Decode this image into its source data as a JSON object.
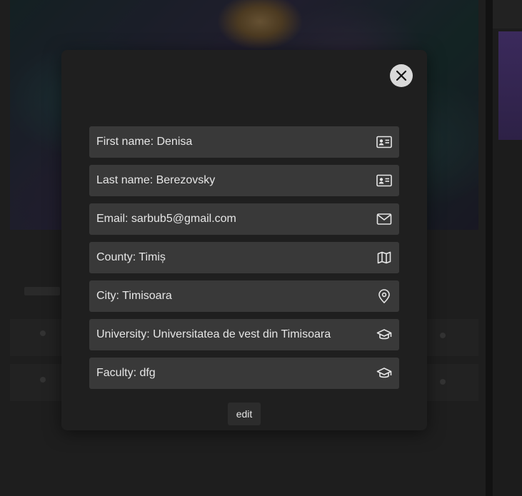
{
  "colors": {
    "modal_bg": "#1f1f1f",
    "field_bg": "#393939",
    "text": "#e6e6e6",
    "close_bg": "#d9d9d9"
  },
  "modal": {
    "fields": [
      {
        "label": "First name: Denisa",
        "icon": "id-card-icon"
      },
      {
        "label": "Last name: Berezovsky",
        "icon": "id-card-icon"
      },
      {
        "label": "Email: sarbub5@gmail.com",
        "icon": "mail-icon"
      },
      {
        "label": "County: Timiș",
        "icon": "map-icon"
      },
      {
        "label": "City: Timisoara",
        "icon": "location-pin-icon"
      },
      {
        "label": "University: Universitatea de vest din Timisoara",
        "icon": "graduation-cap-icon"
      },
      {
        "label": "Faculty: dfg",
        "icon": "graduation-cap-icon"
      }
    ],
    "edit_label": "edit",
    "close_icon": "close-icon"
  }
}
